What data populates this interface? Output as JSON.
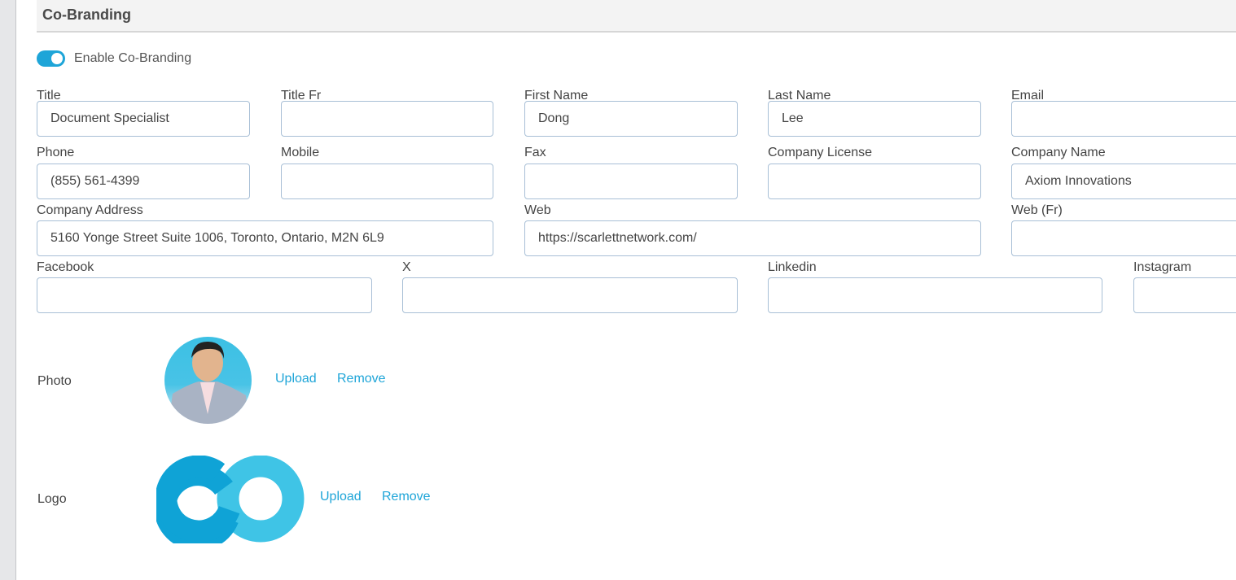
{
  "section": {
    "title": "Co-Branding"
  },
  "toggle": {
    "label": "Enable Co-Branding",
    "on": true
  },
  "fields": {
    "title": {
      "label": "Title",
      "value": "Document Specialist"
    },
    "title_fr": {
      "label": "Title Fr",
      "value": ""
    },
    "first_name": {
      "label": "First Name",
      "value": "Dong"
    },
    "last_name": {
      "label": "Last Name",
      "value": "Lee"
    },
    "email": {
      "label": "Email",
      "value": ""
    },
    "phone": {
      "label": "Phone",
      "value": "(855) 561-4399"
    },
    "mobile": {
      "label": "Mobile",
      "value": ""
    },
    "fax": {
      "label": "Fax",
      "value": ""
    },
    "company_license": {
      "label": "Company License",
      "value": ""
    },
    "company_name": {
      "label": "Company Name",
      "value": "Axiom Innovations"
    },
    "company_address": {
      "label": "Company Address",
      "value": "5160 Yonge Street Suite 1006, Toronto, Ontario, M2N 6L9"
    },
    "web": {
      "label": "Web",
      "value": "https://scarlettnetwork.com/"
    },
    "web_fr": {
      "label": "Web (Fr)",
      "value": ""
    },
    "facebook": {
      "label": "Facebook",
      "value": ""
    },
    "x": {
      "label": "X",
      "value": ""
    },
    "linkedin": {
      "label": "Linkedin",
      "value": ""
    },
    "instagram": {
      "label": "Instagram",
      "value": ""
    }
  },
  "photo": {
    "label": "Photo",
    "upload": "Upload",
    "remove": "Remove"
  },
  "logo": {
    "label": "Logo",
    "upload": "Upload",
    "remove": "Remove"
  },
  "colors": {
    "accent": "#1ea5d8",
    "logo_dark": "#0fa3d6",
    "logo_light": "#3fc4e6"
  }
}
